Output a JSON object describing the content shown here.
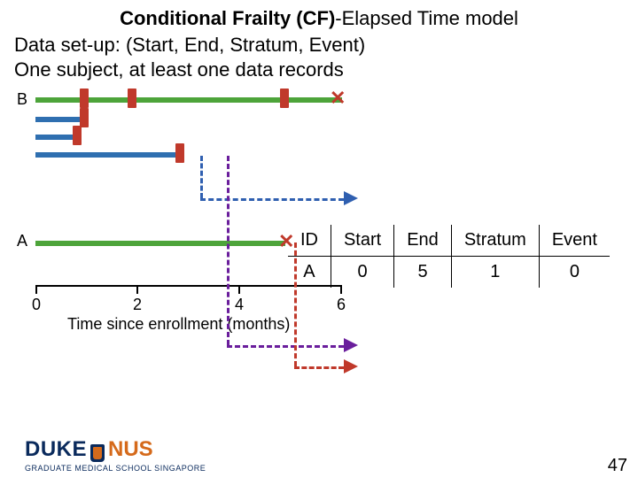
{
  "title_bold": "Conditional Frailty (CF)",
  "title_rest": "-Elapsed Time model",
  "line1": "Data set-up: (Start, End, Stratum, Event)",
  "line2": "One subject, at least one data records",
  "chart_data": {
    "type": "table",
    "xlabel": "Time since enrollment (months)",
    "x_ticks": [
      "0",
      "2",
      "4",
      "6"
    ],
    "subjects": [
      {
        "label": "B",
        "events_at": [
          1,
          2,
          5
        ],
        "censor_at": 6
      },
      {
        "label": "A",
        "events_at": [
          5
        ],
        "censor_at": 5
      }
    ],
    "arrow_colors": [
      "blue",
      "purple",
      "red"
    ]
  },
  "table": {
    "headers": [
      "ID",
      "Start",
      "End",
      "Stratum",
      "Event"
    ],
    "rows": [
      {
        "id": "A",
        "start": "0",
        "end": "5",
        "stratum": "1",
        "event": "0"
      }
    ]
  },
  "logo": {
    "duke": "DUKE",
    "nus": "NUS",
    "sub": "GRADUATE MEDICAL SCHOOL SINGAPORE"
  },
  "page_number": "47"
}
